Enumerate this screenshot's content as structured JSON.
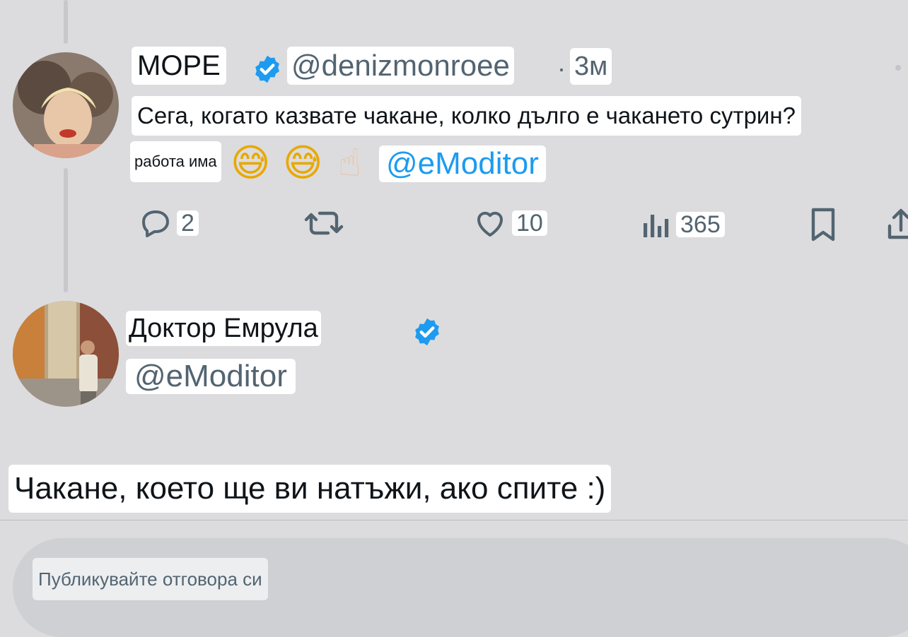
{
  "post": {
    "display_name": "МОРЕ",
    "handle": "@denizmonroee",
    "separator": "·",
    "time": "3м",
    "text_line1": "Сега, когато казвате чакане, колко дълго е чакането сутрин?",
    "text_prefix": "работа има",
    "mention": "@eModitor",
    "emojis": [
      "😅",
      "😅",
      "☝"
    ],
    "stats": {
      "replies": "2",
      "likes": "10",
      "views": "365"
    }
  },
  "reply": {
    "display_name": "Доктор Емрула",
    "handle": "@eModitor",
    "text": "Чакане, което ще ви натъжи, ако спите :)"
  },
  "composer": {
    "placeholder": "Публикувайте отговора си"
  },
  "colors": {
    "background": "#dcdcde",
    "verified_blue": "#1d9bf0",
    "mention_blue": "#1d9bf0",
    "muted_text": "#536471"
  },
  "icons": {
    "reply": "reply-icon",
    "retweet": "retweet-icon",
    "like": "heart-icon",
    "views": "views-icon",
    "bookmark": "bookmark-icon",
    "share": "share-icon",
    "verified": "verified-badge-icon"
  }
}
